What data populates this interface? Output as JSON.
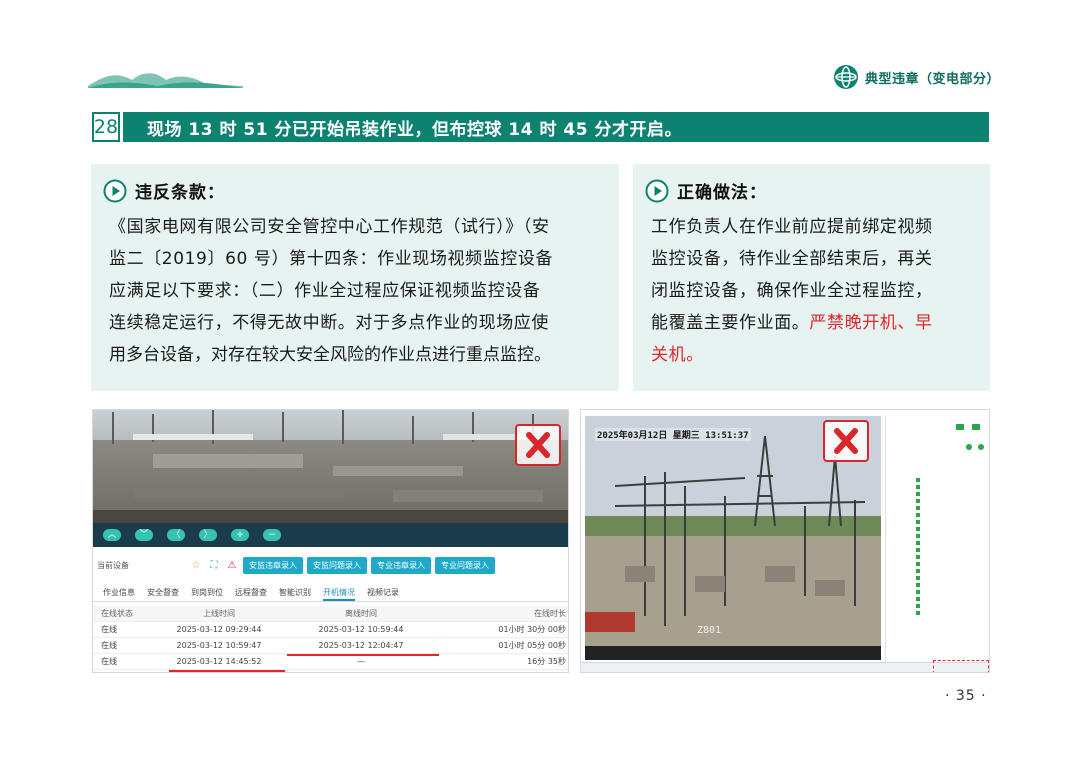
{
  "header": {
    "section_title": "典型违章（变电部分）",
    "brand_color": "#0d8270"
  },
  "item": {
    "number": "28",
    "title": "现场 13 时 51 分已开始吊装作业，但布控球 14 时 45 分才开启。"
  },
  "violation": {
    "label": "违反条款：",
    "lines": [
      "《国家电网有限公司安全管控中心工作规范（试行）》（安",
      "监二〔2019〕60 号）第十四条：作业现场视频监控设备",
      "应满足以下要求：（二）作业全过程应保证视频监控设备",
      "连续稳定运行，不得无故中断。对于多点作业的现场应使",
      "用多台设备，对存在较大安全风险的作业点进行重点监控。"
    ]
  },
  "correct": {
    "label": "正确做法：",
    "lines": [
      "工作负责人在作业前应提前绑定视频",
      "监控设备，待作业全部结束后，再关",
      "闭监控设备，确保作业全过程监控，"
    ],
    "line4_normal": "能覆盖主要作业面。",
    "line4_red": "严禁晚开机、早",
    "line5_red": "关机。"
  },
  "screenshot_left": {
    "controls": [
      "︿",
      "﹀",
      "〈",
      "〉",
      "+",
      "−"
    ],
    "device_label": "当前设备",
    "buttons": [
      "安监违章录入",
      "安监问题录入",
      "专业违章录入",
      "专业问题录入"
    ],
    "tabs": [
      "作业信息",
      "安全督查",
      "到岗到位",
      "远程督查",
      "智能识别",
      "开机情况",
      "视频记录"
    ],
    "active_tab": "开机情况",
    "table_head": [
      "在线状态",
      "上线时间",
      "离线时间",
      "在线时长"
    ],
    "rows": [
      [
        "在线",
        "2025-03-12 09:29:44",
        "2025-03-12 10:59:44",
        "01小时 30分 00秒"
      ],
      [
        "在线",
        "2025-03-12 10:59:47",
        "2025-03-12 12:04:47",
        "01小时 05分 00秒"
      ],
      [
        "在线",
        "2025-03-12 14:45:52",
        "—",
        "16分 35秒"
      ]
    ]
  },
  "screenshot_right": {
    "timestamp": "2025年03月12日  星期三  13:51:37",
    "camera_id": "Z801"
  },
  "page_number": "· 35 ·"
}
